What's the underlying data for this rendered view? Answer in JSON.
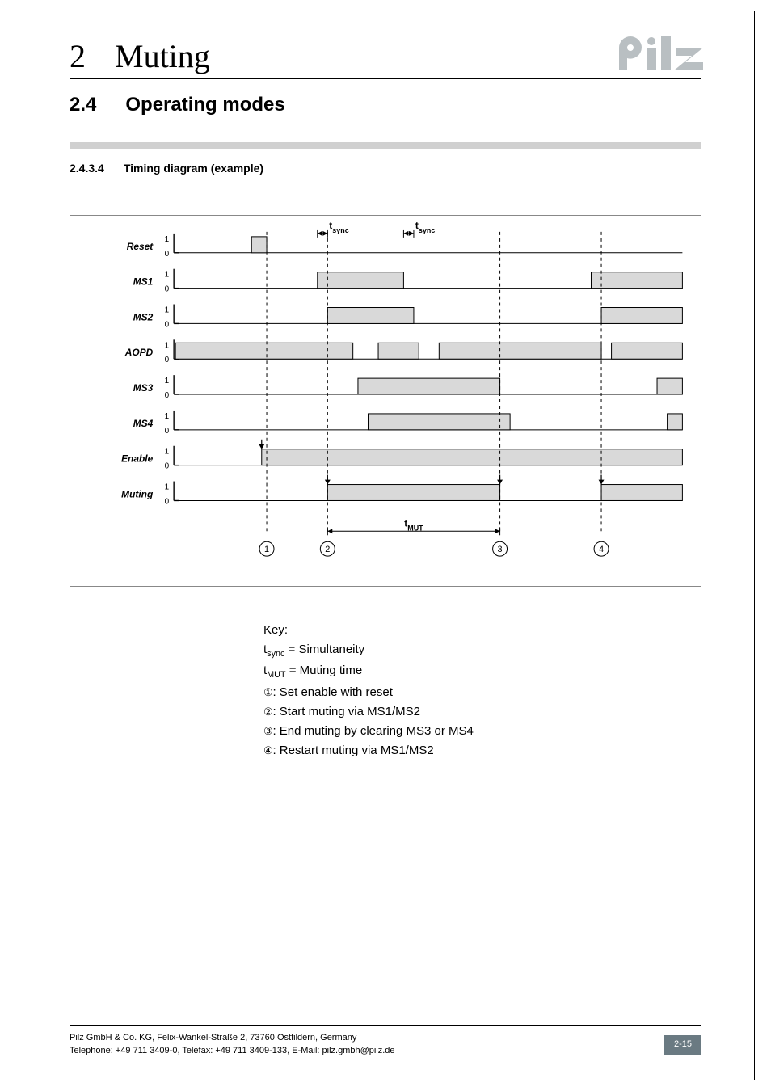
{
  "header": {
    "chapter_number": "2",
    "chapter_title": "Muting",
    "logo_name": "pilz"
  },
  "section": {
    "number": "2.4",
    "title": "Operating modes"
  },
  "subsection": {
    "number": "2.4.3.4",
    "title": "Timing diagram (example)"
  },
  "chart_data": {
    "type": "timing",
    "time_range": [
      0,
      100
    ],
    "signals": [
      {
        "name": "Reset",
        "high_intervals": [
          [
            15,
            18
          ]
        ]
      },
      {
        "name": "MS1",
        "high_intervals": [
          [
            28,
            45
          ],
          [
            82,
            100
          ]
        ]
      },
      {
        "name": "MS2",
        "high_intervals": [
          [
            30,
            47
          ],
          [
            84,
            100
          ]
        ]
      },
      {
        "name": "AOPD",
        "high_intervals": [
          [
            0,
            35
          ],
          [
            40,
            48
          ],
          [
            52,
            84
          ],
          [
            86,
            100
          ]
        ]
      },
      {
        "name": "MS3",
        "high_intervals": [
          [
            36,
            64
          ],
          [
            95,
            100
          ]
        ]
      },
      {
        "name": "MS4",
        "high_intervals": [
          [
            38,
            66
          ],
          [
            97,
            100
          ]
        ]
      },
      {
        "name": "Enable",
        "high_intervals": [
          [
            17,
            100
          ]
        ],
        "markers_down_at": [
          17
        ]
      },
      {
        "name": "Muting",
        "high_intervals": [
          [
            30,
            64
          ],
          [
            84,
            100
          ]
        ],
        "markers_down_at": [
          30,
          64,
          84
        ]
      }
    ],
    "intervals": [
      {
        "label": "t_sync",
        "from": 28,
        "to": 30,
        "y_row": "Reset",
        "arrow": "left"
      },
      {
        "label": "t_sync",
        "from": 45,
        "to": 47,
        "y_row": "Reset",
        "arrow": "left"
      },
      {
        "label": "t_MUT",
        "from": 30,
        "to": 64,
        "y_row": "below",
        "arrow": "both"
      }
    ],
    "event_markers": [
      {
        "id": "1",
        "at": 18
      },
      {
        "id": "2",
        "at": 30
      },
      {
        "id": "3",
        "at": 64
      },
      {
        "id": "4",
        "at": 84
      }
    ],
    "y_levels": [
      "0",
      "1"
    ]
  },
  "key": {
    "heading": "Key:",
    "lines": [
      {
        "prefix": "t",
        "sub": "sync",
        "text": " = Simultaneity"
      },
      {
        "prefix": "t",
        "sub": "MUT",
        "text": " = Muting time"
      },
      {
        "circ": "①",
        "text": ": Set enable with reset"
      },
      {
        "circ": "②",
        "text": ": Start muting via MS1/MS2"
      },
      {
        "circ": "③",
        "text": ": End muting by clearing MS3 or MS4"
      },
      {
        "circ": "④",
        "text": ": Restart muting via MS1/MS2"
      }
    ]
  },
  "footer": {
    "line1": "Pilz GmbH & Co. KG, Felix-Wankel-Straße 2, 73760 Ostfildern, Germany",
    "line2": "Telephone: +49 711 3409-0, Telefax: +49 711 3409-133, E-Mail: pilz.gmbh@pilz.de",
    "page_number": "2-15"
  }
}
